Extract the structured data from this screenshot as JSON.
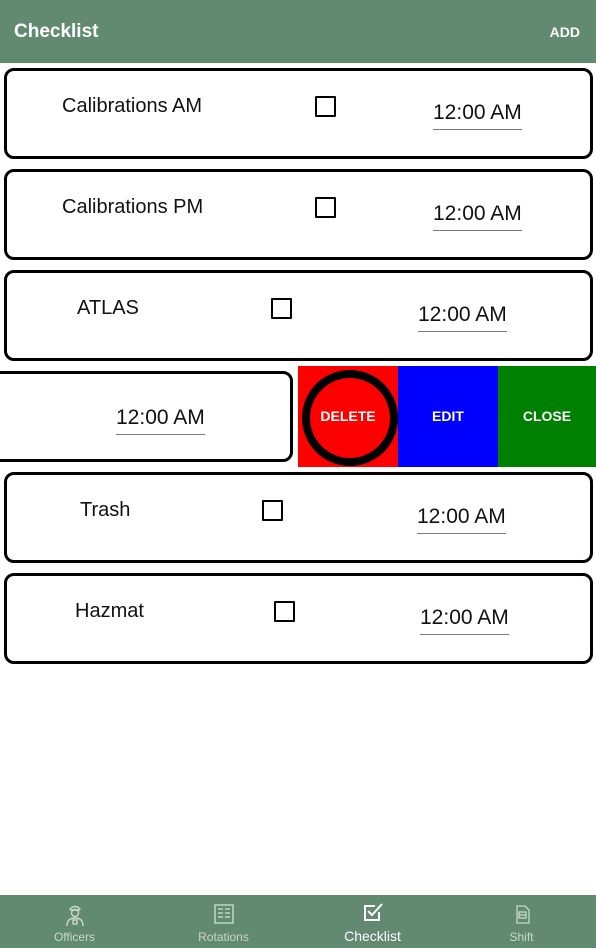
{
  "header": {
    "title": "Checklist",
    "add_label": "ADD"
  },
  "items": [
    {
      "label": "Calibrations AM",
      "checked": false,
      "time": "12:00 AM"
    },
    {
      "label": "Calibrations PM",
      "checked": false,
      "time": "12:00 AM"
    },
    {
      "label": "ATLAS",
      "checked": false,
      "time": "12:00 AM"
    },
    {
      "label": "",
      "checked": false,
      "time": "12:00 AM"
    },
    {
      "label": "Trash",
      "checked": false,
      "time": "12:00 AM"
    },
    {
      "label": "Hazmat",
      "checked": false,
      "time": "12:00 AM"
    }
  ],
  "swipe_actions": {
    "delete": "DELETE",
    "edit": "EDIT",
    "close": "CLOSE"
  },
  "nav": [
    {
      "label": "Officers",
      "icon": "officer-icon"
    },
    {
      "label": "Rotations",
      "icon": "rotations-icon"
    },
    {
      "label": "Checklist",
      "icon": "checklist-icon",
      "active": true
    },
    {
      "label": "Shift",
      "icon": "shift-icon"
    }
  ],
  "colors": {
    "primary": "#618a70",
    "delete": "#ff0000",
    "edit": "#0000ff",
    "close": "#008000"
  }
}
